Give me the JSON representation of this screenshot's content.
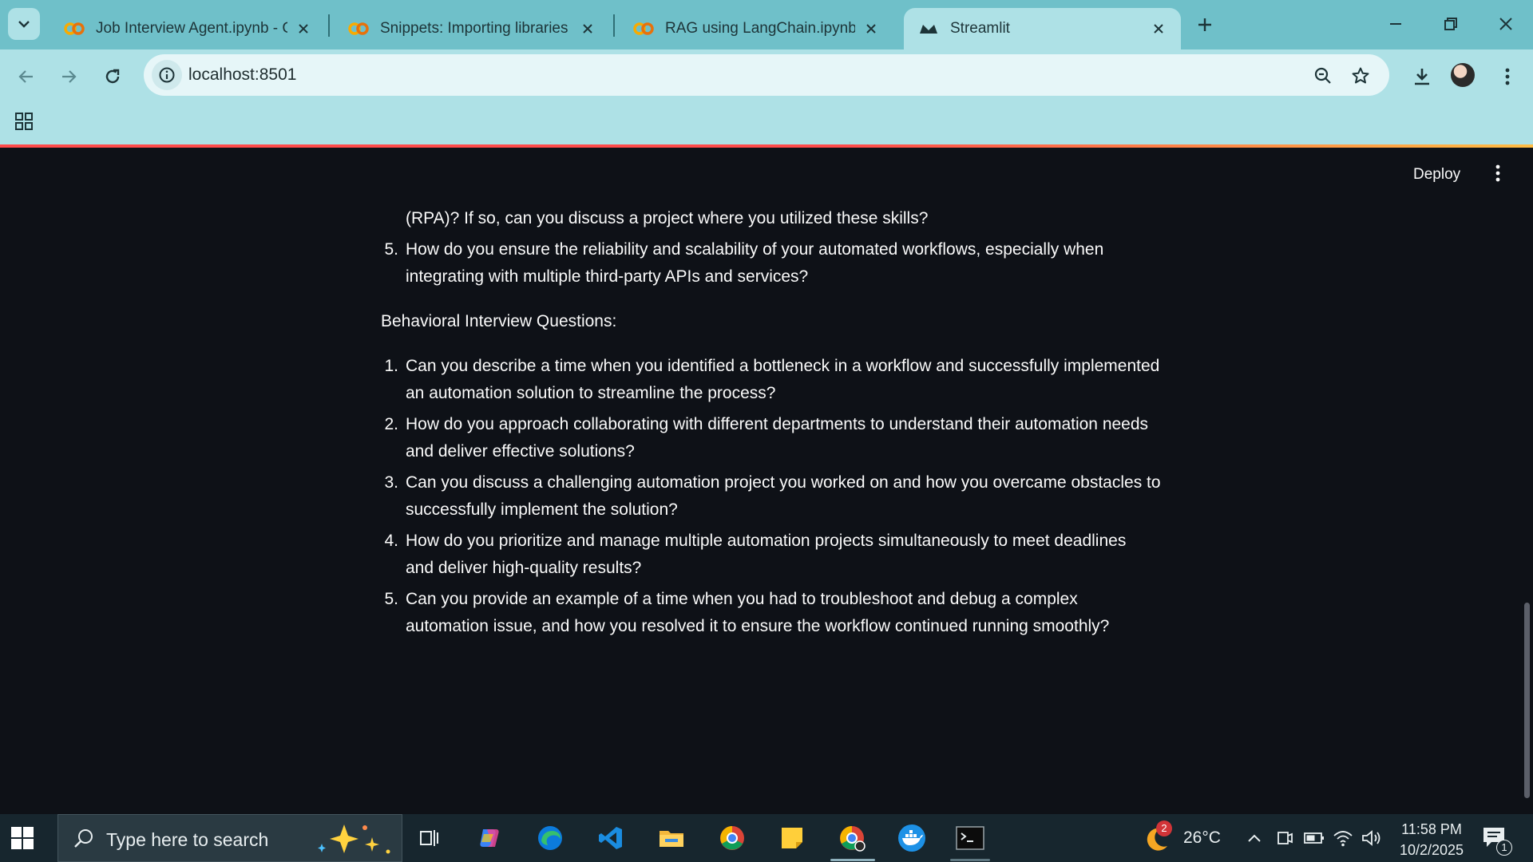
{
  "browser": {
    "tabs": [
      {
        "title": "Job Interview Agent.ipynb - Col",
        "favicon": "colab-icon",
        "active": false
      },
      {
        "title": "Snippets: Importing libraries - C",
        "favicon": "colab-icon",
        "active": false
      },
      {
        "title": "RAG using LangChain.ipynb - C",
        "favicon": "colab-icon",
        "active": false
      },
      {
        "title": "Streamlit",
        "favicon": "streamlit-icon",
        "active": true
      }
    ],
    "url": "localhost:8501",
    "colors": {
      "tabstrip": "#6fc0c9",
      "toolbar": "#aee1e6",
      "omnibox": "#e6f6f8"
    }
  },
  "app": {
    "deploy_label": "Deploy",
    "partial_line": "(RPA)? If so, can you discuss a project where you utilized these skills?",
    "technical_tail": {
      "number": "5.",
      "lines": [
        "How do you ensure the reliability and scalability of your automated workflows, especially when",
        "integrating with multiple third-party APIs and services?"
      ]
    },
    "behavioral_heading": "Behavioral Interview Questions:",
    "behavioral_questions": [
      {
        "number": "1.",
        "lines": [
          "Can you describe a time when you identified a bottleneck in a workflow and successfully implemented",
          "an automation solution to streamline the process?"
        ]
      },
      {
        "number": "2.",
        "lines": [
          "How do you approach collaborating with different departments to understand their automation needs",
          "and deliver effective solutions?"
        ]
      },
      {
        "number": "3.",
        "lines": [
          "Can you discuss a challenging automation project you worked on and how you overcame obstacles to",
          "successfully implement the solution?"
        ]
      },
      {
        "number": "4.",
        "lines": [
          "How do you prioritize and manage multiple automation projects simultaneously to meet deadlines",
          "and deliver high-quality results?"
        ]
      },
      {
        "number": "5.",
        "lines": [
          "Can you provide an example of a time when you had to troubleshoot and debug a complex",
          "automation issue, and how you resolved it to ensure the workflow continued running smoothly?"
        ]
      }
    ],
    "colors": {
      "background": "#0e1117",
      "text": "#fafafa",
      "accent": "#ff4b4b"
    }
  },
  "taskbar": {
    "search_placeholder": "Type here to search",
    "weather_temp": "26°C",
    "weather_badge": "2",
    "time": "11:58 PM",
    "date": "10/2/2025",
    "notification_count": "1"
  }
}
